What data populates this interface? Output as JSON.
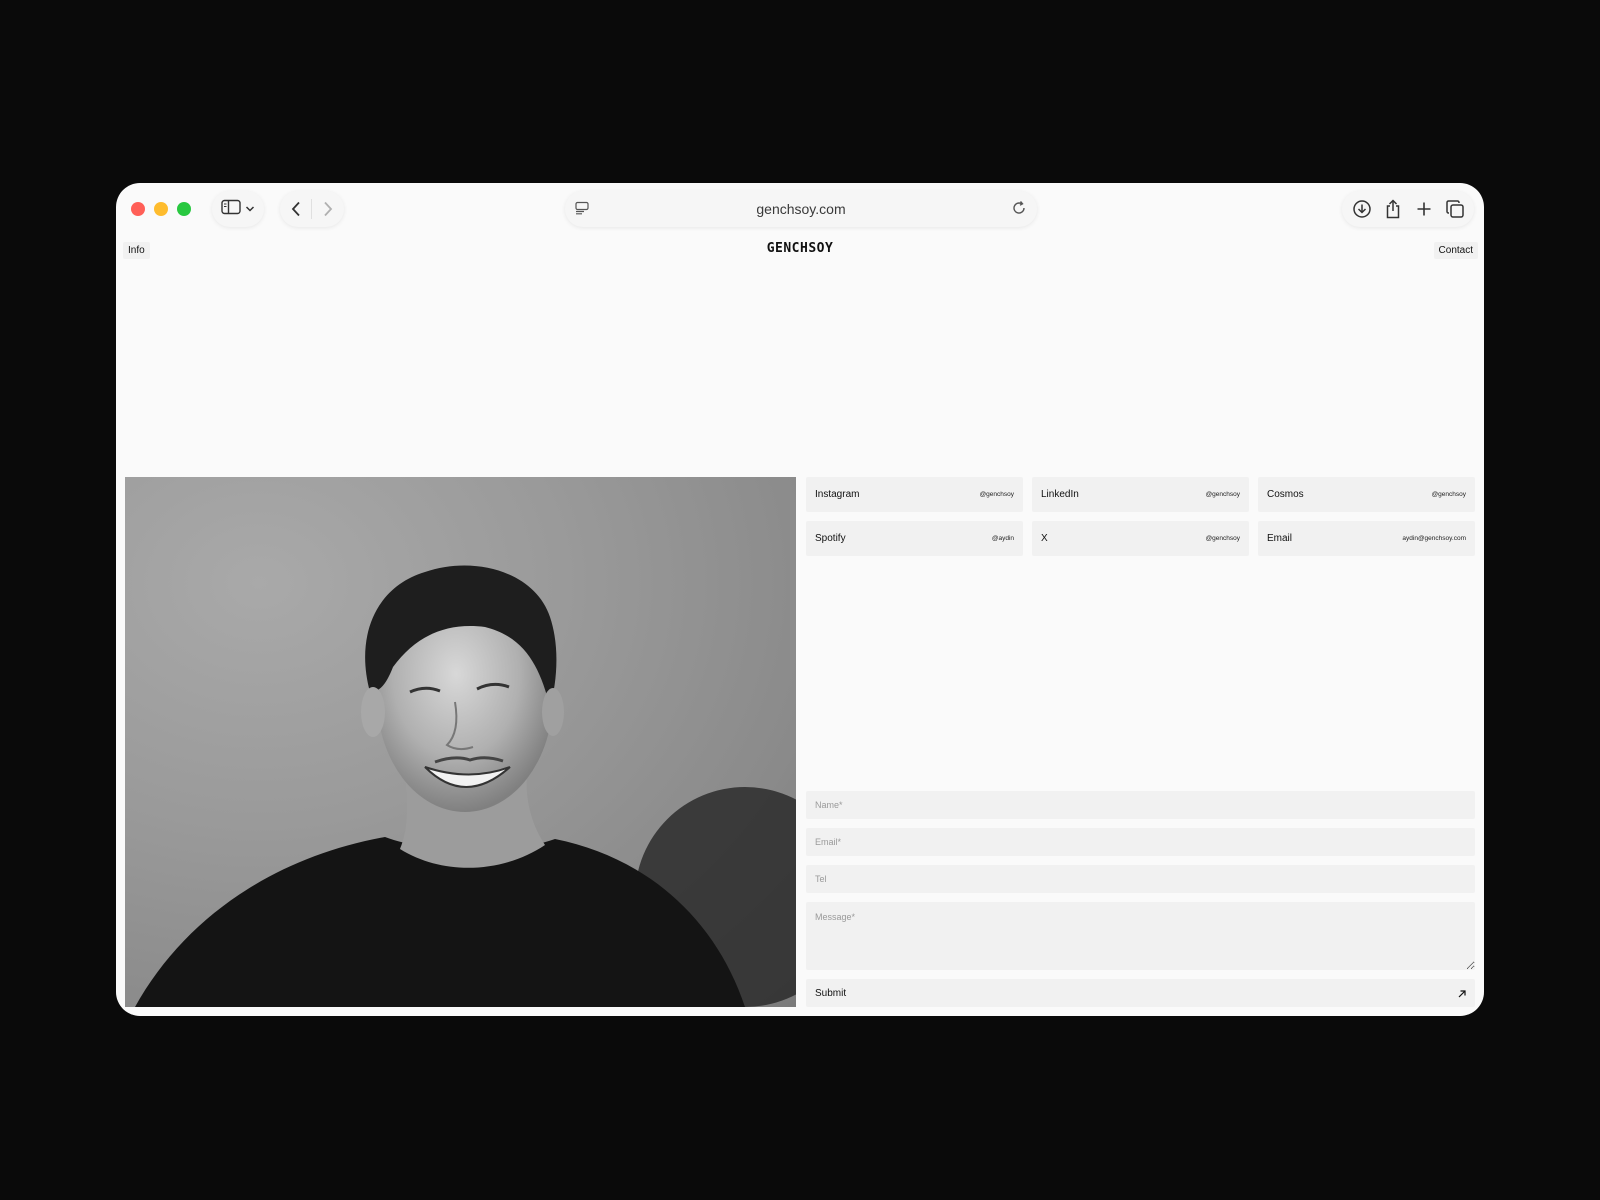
{
  "browser": {
    "url": "genchsoy.com"
  },
  "header": {
    "info_label": "Info",
    "logo": "GENCHSOY",
    "contact_label": "Contact"
  },
  "links": [
    {
      "name": "Instagram",
      "handle": "@genchsoy"
    },
    {
      "name": "LinkedIn",
      "handle": "@genchsoy"
    },
    {
      "name": "Cosmos",
      "handle": "@genchsoy"
    },
    {
      "name": "Spotify",
      "handle": "@aydin"
    },
    {
      "name": "X",
      "handle": "@genchsoy"
    },
    {
      "name": "Email",
      "handle": "aydin@genchsoy.com"
    }
  ],
  "form": {
    "name_placeholder": "Name*",
    "email_placeholder": "Email*",
    "tel_placeholder": "Tel",
    "message_placeholder": "Message*",
    "submit_label": "Submit"
  }
}
